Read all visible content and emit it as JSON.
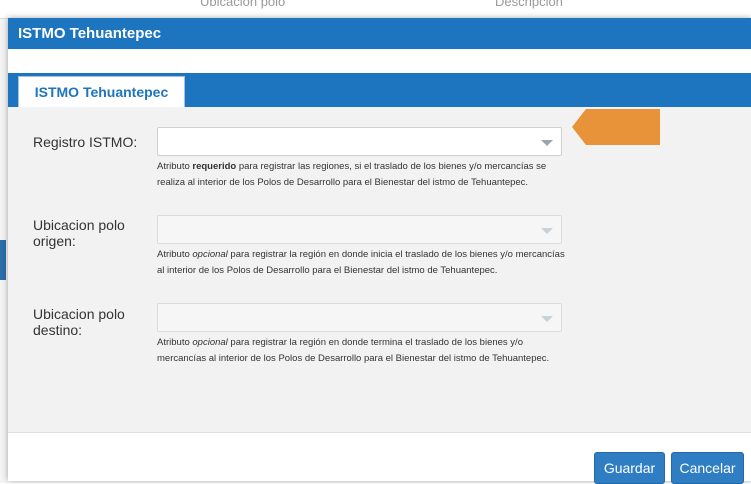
{
  "background": {
    "col1_text": "Ubicacion polo",
    "col2_text": "Descripcion"
  },
  "modal": {
    "title": "ISTMO Tehuantepec",
    "tab_label": "ISTMO Tehuantepec"
  },
  "fields": [
    {
      "label": "Registro ISTMO:",
      "value": "",
      "enabled": true,
      "help_pre": "Atributo ",
      "help_em": "requerido",
      "help_post": " para registrar las regiones, si el traslado de los bienes y/o mercancías se realiza al interior de los Polos de Desarrollo para el Bienestar del istmo de Tehuantepec."
    },
    {
      "label": "Ubicacion polo origen:",
      "value": "",
      "enabled": false,
      "help_pre": "Atributo ",
      "help_em": "opcional",
      "help_post": " para registrar la región en donde inicia el traslado de los bienes y/o mercancías al interior de los Polos de Desarrollo para el Bienestar del istmo de Tehuantepec."
    },
    {
      "label": "Ubicacion polo destino:",
      "value": "",
      "enabled": false,
      "help_pre": "Atributo ",
      "help_em": "opcional",
      "help_post": " para registrar la región en donde termina el traslado de los bienes y/o mercancías al interior de los Polos de Desarrollo para el Bienestar del istmo de Tehuantepec."
    }
  ],
  "footer": {
    "save_label": "Guardar",
    "cancel_label": "Cancelar"
  },
  "colors": {
    "header_blue": "#1d75c0",
    "button_blue": "#2f7ec4",
    "indicator_orange": "#e8923a",
    "content_gray": "#f2f2f2"
  },
  "icons": {
    "dropdown": "chevron-down-icon",
    "indicator": "arrow-left-indicator"
  }
}
